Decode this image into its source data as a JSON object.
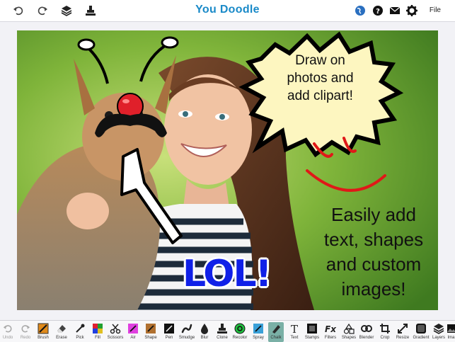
{
  "app": {
    "title": "You Doodle"
  },
  "topbar": {
    "left_icons": [
      "undo-icon",
      "redo-icon",
      "layers-icon",
      "stamp-tool-icon"
    ],
    "right_icons": [
      "globe-icon",
      "help-icon",
      "mail-icon",
      "gear-icon"
    ],
    "file_label": "File"
  },
  "canvas": {
    "bubble_lines": [
      "Draw on",
      "photos and",
      "add clipart!"
    ],
    "feature_lines": [
      "Easily add",
      "text, shapes",
      "and custom",
      "images!"
    ],
    "lol_text": "LOL!"
  },
  "colors": {
    "title": "#1a8ac8",
    "lol": "#1020e8",
    "smile": "#e01818",
    "active_tool": "#7ab0a6"
  },
  "tools": [
    {
      "label": "Undo",
      "icon": "undo-icon"
    },
    {
      "label": "Redo",
      "icon": "redo-icon"
    },
    {
      "label": "Brush",
      "icon": "brush-icon"
    },
    {
      "label": "Erase",
      "icon": "eraser-icon"
    },
    {
      "label": "Pick",
      "icon": "eyedropper-icon"
    },
    {
      "label": "Fill",
      "icon": "fill-icon"
    },
    {
      "label": "Scissors",
      "icon": "scissors-icon"
    },
    {
      "label": "Air",
      "icon": "airbrush-icon"
    },
    {
      "label": "Shape",
      "icon": "shape-icon"
    },
    {
      "label": "Pen",
      "icon": "pen-icon"
    },
    {
      "label": "Smudge",
      "icon": "smudge-icon"
    },
    {
      "label": "Blur",
      "icon": "blur-icon"
    },
    {
      "label": "Clone",
      "icon": "clone-stamp-icon"
    },
    {
      "label": "Recolor",
      "icon": "recolor-icon"
    },
    {
      "label": "Spray",
      "icon": "spray-icon"
    },
    {
      "label": "Chalk",
      "icon": "chalk-icon"
    },
    {
      "label": "Text",
      "icon": "text-icon"
    },
    {
      "label": "Stamps",
      "icon": "stamps-icon"
    },
    {
      "label": "Filters",
      "icon": "filters-icon"
    },
    {
      "label": "Shapes",
      "icon": "shapes-icon"
    },
    {
      "label": "Blender",
      "icon": "blender-icon"
    },
    {
      "label": "Crop",
      "icon": "crop-icon"
    },
    {
      "label": "Resize",
      "icon": "resize-icon"
    },
    {
      "label": "Gradient",
      "icon": "gradient-icon"
    },
    {
      "label": "Layers",
      "icon": "layers-icon"
    },
    {
      "label": "Ima",
      "icon": "image-icon"
    }
  ],
  "active_tool": "Chalk"
}
